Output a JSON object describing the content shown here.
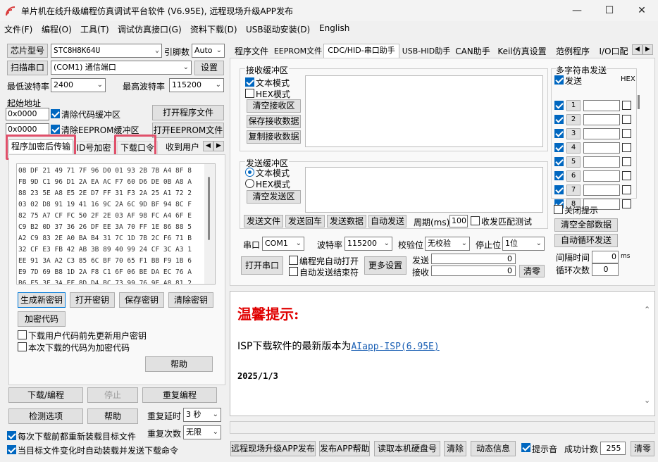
{
  "window": {
    "title": "单片机在线升级编程仿真调试平台软件 (V6.95E), 远程现场升级APP发布",
    "minimize": "—",
    "maximize": "☐",
    "close": "✕"
  },
  "menu": [
    "文件(F)",
    "编程(O)",
    "工具(T)",
    "调试仿真接口(G)",
    "资料下载(D)",
    "USB驱动安装(D)",
    "English"
  ],
  "left": {
    "chip_label": "芯片型号",
    "chip_value": "STC8H8K64U",
    "pins_label": "引脚数",
    "pins_value": "Auto",
    "scan_port": "扫描串口",
    "port_value": "(COM1) 通信端口",
    "settings": "设置",
    "min_baud_label": "最低波特率",
    "min_baud": "2400",
    "max_baud_label": "最高波特率",
    "max_baud": "115200",
    "start_addr_label": "起始地址",
    "addr1": "0x0000",
    "clear_code": "清除代码缓冲区",
    "open_prog": "打开程序文件",
    "addr2": "0x0000",
    "clear_eeprom": "清除EEPROM缓冲区",
    "open_eeprom": "打开EEPROM文件",
    "tabs": [
      "程序加密后传输",
      "ID号加密",
      "下载口令",
      "收到用户"
    ],
    "hex_lines": [
      "08 DF 21 49 71 7F 96 D0 01 93 2B 7B A4 8F 8",
      "FB 9D C1 96 D1 2A EA AC F7 60 D6 DE 0B A8 A",
      "88 23 5E A8 E5 2E D7 FF 31 F3 2A 25 A1 72 2",
      "03 02 D8 91 19 41 16 9C 2A 6C 9D BF 94 8C F",
      "82 75 A7 CF FC 50 2F 2E 03 AF 98 FC A4 6F E",
      "C9 B2 0D 37 36 26 DF EE 3A 70 FF 1E 86 88 5",
      "A2 C9 83 2E A0 BA B4 31 7C 1D 7B 2C F6 71 B",
      "32 CF E3 FB 42 AB 3B 89 40 99 24 CF 3C A3 1",
      "EE 91 3A A2 C3 85 6C BF 70 65 F1 BB F9 1B 6",
      "E9 7D 69 B8 1D 2A F8 C1 6F 06 BE DA EC 76 A",
      "B6 F5 3F 3A EF 8D D4 BC 73 99 76 9E A8 81 2"
    ],
    "gen_key": "生成新密钥",
    "open_key": "打开密钥",
    "save_key": "保存密钥",
    "clear_key": "清除密钥",
    "encrypt_code": "加密代码",
    "cb_update_key": "下载用户代码前先更新用户密钥",
    "cb_encrypted": "本次下载的代码为加密代码",
    "help": "帮助",
    "download": "下载/编程",
    "stop": "停止",
    "reprogram": "重复编程",
    "check_options": "检测选项",
    "help2": "帮助",
    "repeat_delay_label": "重复延时",
    "repeat_delay": "3 秒",
    "repeat_count_label": "重复次数",
    "repeat_count": "无限",
    "cb_reload": "每次下载前都重新装载目标文件",
    "cb_auto": "当目标文件变化时自动装载并发送下载命令"
  },
  "right_tabs": [
    "程序文件",
    "EEPROM文件",
    "CDC/HID-串口助手",
    "USB-HID助手",
    "CAN助手",
    "Keil仿真设置",
    "范例程序",
    "I/O口配"
  ],
  "serial": {
    "recv_group": "接收缓冲区",
    "text_mode": "文本模式",
    "hex_mode": "HEX模式",
    "clear_recv": "清空接收区",
    "save_recv": "保存接收数据",
    "copy_recv": "复制接收数据",
    "send_group": "发送缓冲区",
    "send_text_mode": "文本模式",
    "send_hex_mode": "HEX模式",
    "clear_send": "清空发送区",
    "send_file": "发送文件",
    "send_back": "发送回车",
    "send_data": "发送数据",
    "auto_send": "自动发送",
    "period_label": "周期(ms)",
    "period": "100",
    "match_test": "收发匹配测试",
    "multi_title": "多字符串发送",
    "multi_send": "发送",
    "hex_col": "HEX",
    "rows": [
      "1",
      "2",
      "3",
      "4",
      "5",
      "6",
      "7",
      "8"
    ],
    "close_prompt": "关闭提示",
    "clear_all": "清空全部数据",
    "auto_loop": "自动循环发送",
    "interval_label": "间隔时间",
    "interval": "0",
    "interval_unit": "ms",
    "loop_label": "循环次数",
    "loop": "0",
    "port_label": "串口",
    "port": "COM1",
    "baud_label": "波特率",
    "baud": "115200",
    "parity_label": "校验位",
    "parity": "无校验",
    "stop_label": "停止位",
    "stop": "1位",
    "open_port": "打开串口",
    "cb_auto_open": "编程完自动打开",
    "cb_auto_end": "自动发送结束符",
    "more_settings": "更多设置",
    "send_lbl": "发送",
    "send_count": "0",
    "recv_lbl": "接收",
    "recv_count": "0",
    "clear_counts": "清零"
  },
  "notice": {
    "title": "温馨提示:",
    "line_prefix": "ISP下载软件的最新版本为",
    "link": "AIapp-ISP(6.95E)",
    "date": "2025/1/3"
  },
  "bottom": {
    "publish": "远程现场升级APP发布",
    "publish_help": "发布APP帮助",
    "read_disk": "读取本机硬盘号",
    "clear": "清除",
    "dyn_info": "动态信息",
    "beep": "提示音",
    "success_label": "成功计数",
    "success": "255",
    "reset": "清零"
  },
  "colors": {
    "accent": "#0067c0",
    "highlight": "#e0506a",
    "notice_title": "#e00000",
    "link": "#1a5fb4"
  }
}
